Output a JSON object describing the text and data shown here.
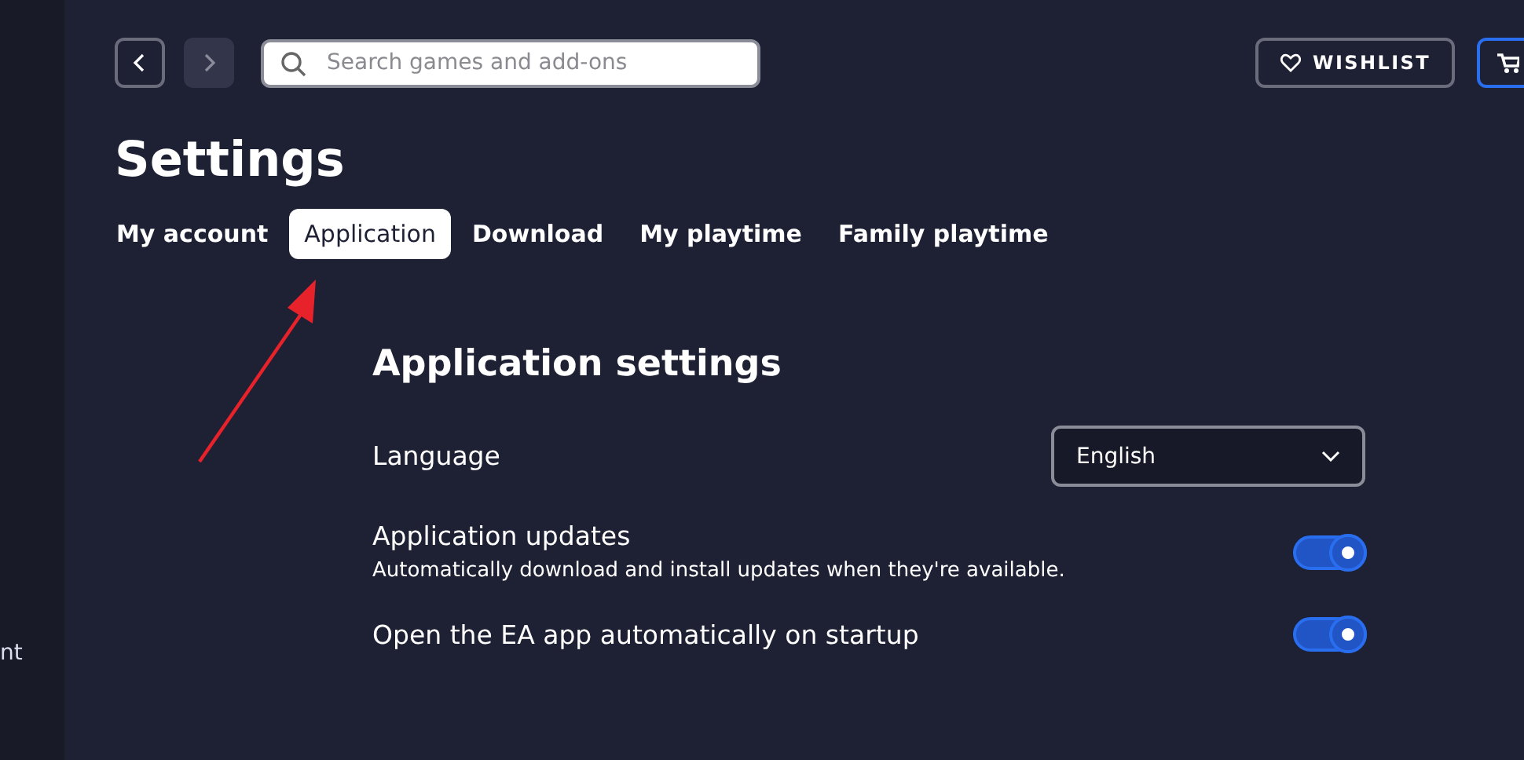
{
  "sidebar": {
    "items": [
      {
        "label": "nt"
      }
    ]
  },
  "top_bar": {
    "search": {
      "placeholder": "Search games and add-ons"
    },
    "forward_disabled": true,
    "wishlist": {
      "label": "WISHLIST"
    }
  },
  "page": {
    "title": "Settings"
  },
  "tabs": [
    {
      "label": "My account",
      "selected": false
    },
    {
      "label": "Application",
      "selected": true
    },
    {
      "label": "Download",
      "selected": false
    },
    {
      "label": "My playtime",
      "selected": false
    },
    {
      "label": "Family playtime",
      "selected": false
    }
  ],
  "section": {
    "title": "Application settings",
    "rows": [
      {
        "kind": "dropdown",
        "label": "Language",
        "value": "English"
      },
      {
        "kind": "toggle",
        "label": "Application updates",
        "description": "Automatically download and install updates when they're available.",
        "on": true
      },
      {
        "kind": "toggle",
        "label": "Open the EA app automatically on startup",
        "on": true
      }
    ]
  }
}
